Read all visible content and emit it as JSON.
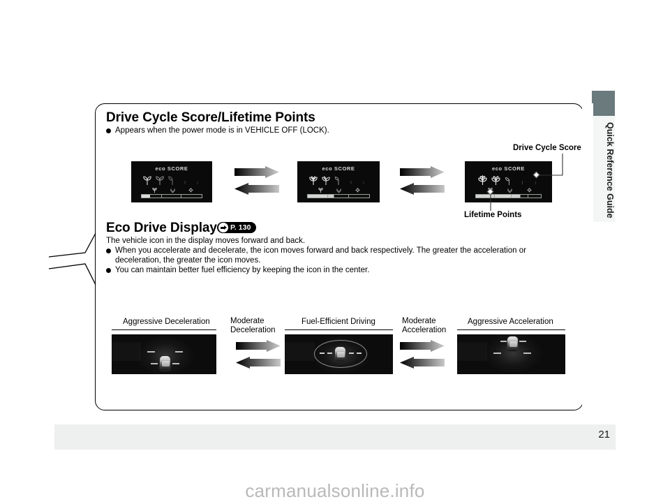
{
  "page": {
    "number": "21",
    "watermark": "carmanualsonline.info",
    "side_tab_label": "Quick Reference Guide"
  },
  "section_one": {
    "title": "Drive Cycle Score/Lifetime Points",
    "bullet": "Appears when the power mode is in VEHICLE OFF (LOCK).",
    "callouts": {
      "drive_cycle_score": "Drive Cycle Score",
      "lifetime_points": "Lifetime Points"
    },
    "displays": [
      {
        "name": "eco-score-low",
        "title": "eco SCORE",
        "leaves_lit": 1,
        "bar_fill_segments": 1,
        "bar_partial": 0.42
      },
      {
        "name": "eco-score-mid",
        "title": "eco SCORE",
        "leaves_lit": 2,
        "bar_fill_segments": 2,
        "bar_partial": 0.3
      },
      {
        "name": "eco-score-high",
        "title": "eco SCORE",
        "leaves_lit": 3,
        "bar_fill_segments": 3,
        "bar_partial": 0.55
      }
    ]
  },
  "section_two": {
    "title": "Eco Drive Display",
    "page_ref": "P. 130",
    "intro": "The vehicle icon in the display moves forward and back.",
    "bullets": [
      "When you accelerate and decelerate, the icon moves forward and back respectively. The greater the acceleration or deceleration, the greater the icon moves.",
      "You can maintain better fuel efficiency by keeping the icon in the center."
    ],
    "labels": {
      "aggressive_deceleration": "Aggressive Deceleration",
      "moderate_deceleration_l1": "Moderate",
      "moderate_deceleration_l2": "Deceleration",
      "fuel_efficient_driving": "Fuel-Efficient Driving",
      "moderate_acceleration_l1": "Moderate",
      "moderate_acceleration_l2": "Acceleration",
      "aggressive_acceleration": "Aggressive Acceleration"
    }
  },
  "colors": {
    "tab_gray": "#6b7a7c",
    "footer_gray": "#eeefef",
    "display_black": "#0a0a0a",
    "watermark_gray": "#b9b9b9"
  }
}
